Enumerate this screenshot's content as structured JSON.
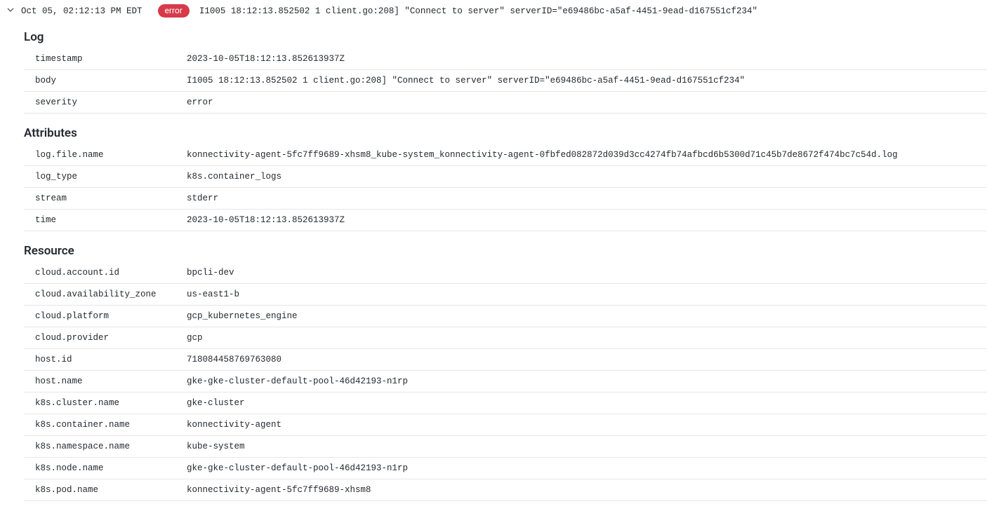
{
  "header": {
    "timestamp_short": "Oct 05, 02:12:13 PM EDT",
    "severity": "error",
    "message": "I1005 18:12:13.852502 1 client.go:208] \"Connect to server\" serverID=\"e69486bc-a5af-4451-9ead-d167551cf234\""
  },
  "sections": {
    "log_title": "Log",
    "attributes_title": "Attributes",
    "resource_title": "Resource"
  },
  "log": {
    "timestamp_k": "timestamp",
    "timestamp_v": "2023-10-05T18:12:13.852613937Z",
    "body_k": "body",
    "body_v": "I1005 18:12:13.852502       1 client.go:208] \"Connect to server\" serverID=\"e69486bc-a5af-4451-9ead-d167551cf234\"",
    "severity_k": "severity",
    "severity_v": "error"
  },
  "attributes": {
    "logfilename_k": "log.file.name",
    "logfilename_v": "konnectivity-agent-5fc7ff9689-xhsm8_kube-system_konnectivity-agent-0fbfed082872d039d3cc4274fb74afbcd6b5300d71c45b7de8672f474bc7c54d.log",
    "logtype_k": "log_type",
    "logtype_v": "k8s.container_logs",
    "stream_k": "stream",
    "stream_v": "stderr",
    "time_k": "time",
    "time_v": "2023-10-05T18:12:13.852613937Z"
  },
  "resource": {
    "cloud_account_id_k": "cloud.account.id",
    "cloud_account_id_v": "bpcli-dev",
    "cloud_az_k": "cloud.availability_zone",
    "cloud_az_v": "us-east1-b",
    "cloud_platform_k": "cloud.platform",
    "cloud_platform_v": "gcp_kubernetes_engine",
    "cloud_provider_k": "cloud.provider",
    "cloud_provider_v": "gcp",
    "host_id_k": "host.id",
    "host_id_v": "718084458769763080",
    "host_name_k": "host.name",
    "host_name_v": "gke-gke-cluster-default-pool-46d42193-n1rp",
    "k8s_cluster_k": "k8s.cluster.name",
    "k8s_cluster_v": "gke-cluster",
    "k8s_container_k": "k8s.container.name",
    "k8s_container_v": "konnectivity-agent",
    "k8s_namespace_k": "k8s.namespace.name",
    "k8s_namespace_v": "kube-system",
    "k8s_node_k": "k8s.node.name",
    "k8s_node_v": "gke-gke-cluster-default-pool-46d42193-n1rp",
    "k8s_pod_k": "k8s.pod.name",
    "k8s_pod_v": "konnectivity-agent-5fc7ff9689-xhsm8"
  }
}
